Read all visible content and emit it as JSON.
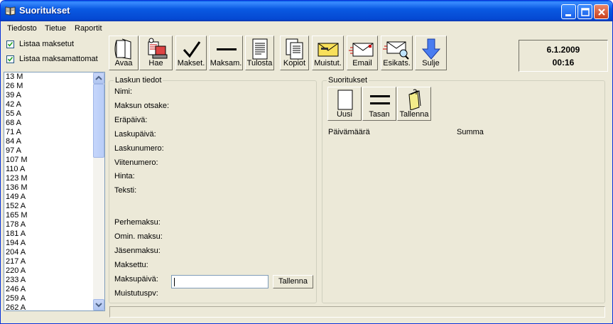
{
  "window": {
    "title": "Suoritukset"
  },
  "menu": [
    "Tiedosto",
    "Tietue",
    "Raportit"
  ],
  "filters": {
    "paid_label": "Listaa maksetut",
    "unpaid_label": "Listaa maksamattomat",
    "paid_checked": true,
    "unpaid_checked": true
  },
  "toolbar": [
    {
      "label": "Avaa",
      "icon": "open-icon"
    },
    {
      "label": "Hae",
      "icon": "fetch-icon"
    },
    {
      "label": "Makset.",
      "icon": "checkmark-icon"
    },
    {
      "label": "Maksam.",
      "icon": "dash-icon"
    },
    {
      "label": "Tulosta",
      "icon": "print-document-icon"
    },
    {
      "label": "Kopiot",
      "icon": "copies-icon"
    },
    {
      "label": "Muistut.",
      "icon": "reminder-envelope-icon"
    },
    {
      "label": "Email",
      "icon": "email-icon"
    },
    {
      "label": "Esikats.",
      "icon": "preview-icon"
    },
    {
      "label": "Sulje",
      "icon": "close-arrow-icon"
    }
  ],
  "clock": {
    "date": "6.1.2009",
    "time": "00:16"
  },
  "list_items": [
    "13 M",
    "26 M",
    "39 A",
    "42 A",
    "55 A",
    "68 A",
    "71 A",
    "84 A",
    "97 A",
    "107 M",
    "110 A",
    "123 M",
    "136 M",
    "149 A",
    "152 A",
    "165 M",
    "178 A",
    "181 A",
    "194 A",
    "204 A",
    "217 A",
    "220 A",
    "233 A",
    "246 A",
    "259 A",
    "262 A"
  ],
  "invoice": {
    "group_title": "Laskun tiedot",
    "fields": [
      "Nimi:",
      "Maksun otsake:",
      "Eräpäivä:",
      "Laskupäivä:",
      "Laskunumero:",
      "Viitenumero:",
      "Hinta:",
      "Teksti:"
    ],
    "fields2": [
      "Perhemaksu:",
      "Omin. maksu:",
      "Jäsenmaksu:",
      "Maksettu:",
      "Maksupäivä:",
      "Muistutuspv:"
    ],
    "payment_date_value": "",
    "save_label": "Tallenna"
  },
  "payments": {
    "group_title": "Suoritukset",
    "buttons": [
      {
        "label": "Uusi",
        "icon": "new-page-icon"
      },
      {
        "label": "Tasan",
        "icon": "equals-icon"
      },
      {
        "label": "Tallenna",
        "icon": "save-folder-icon"
      }
    ],
    "columns": [
      "Päivämäärä",
      "Summa"
    ]
  },
  "status": {
    "text": ""
  }
}
